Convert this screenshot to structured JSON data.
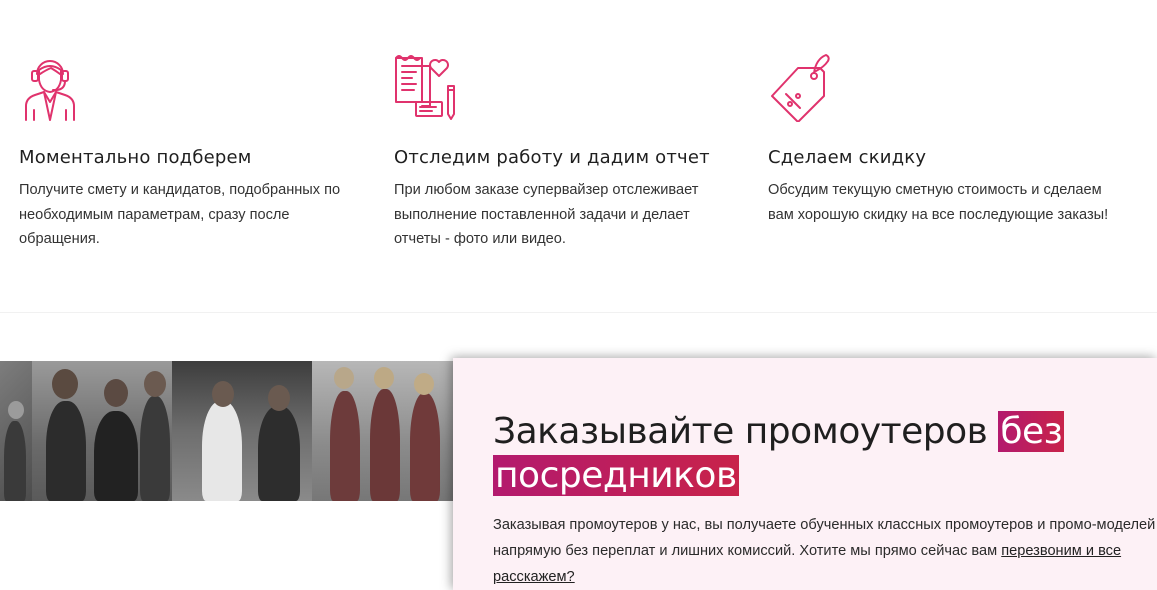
{
  "features": [
    {
      "icon": "support-operator-icon",
      "title": "Моментально подберем",
      "text": "Получите смету и кандидатов, подобранных по необходимым параметрам, сразу после обращения."
    },
    {
      "icon": "documents-heart-icon",
      "title": "Отследим работу и дадим отчет",
      "text": "При любом заказе супервайзер отслеживает выполнение поставленной задачи и делает отчеты - фото или видео."
    },
    {
      "icon": "discount-tag-icon",
      "title": "Сделаем скидку",
      "text": "Обсудим текущую сметную стоимость и сделаем вам хорошую скидку на все последующие заказы!"
    }
  ],
  "promo": {
    "title_start": "Заказывайте промоутеров ",
    "title_highlight_1": "без",
    "title_highlight_2": "посредников",
    "text": "Заказывая промоутеров у нас, вы получаете обученных классных промоутеров и промо-моделей напрямую без переплат и лишних комиссий. Хотите мы прямо сейчас вам ",
    "link": "перезвоним и все расскажем?"
  },
  "colors": {
    "accent": "#e0336d",
    "highlight_from": "#b31a6e",
    "highlight_to": "#c8234a",
    "promo_bg": "#fdf1f6"
  }
}
